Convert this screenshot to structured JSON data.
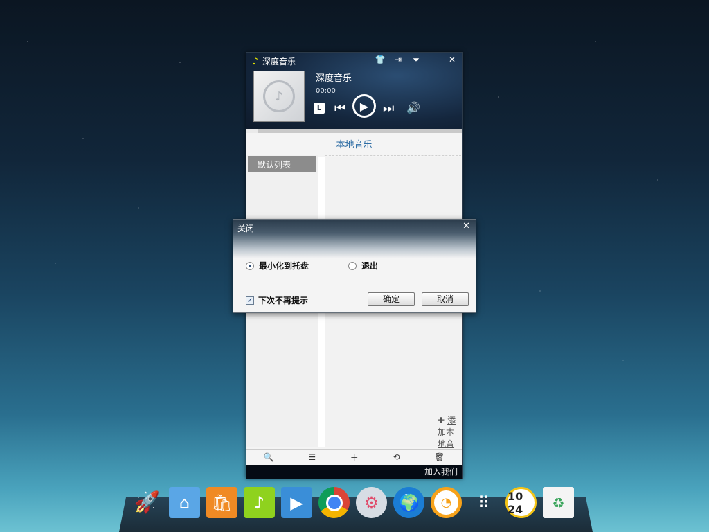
{
  "player": {
    "app_title": "深度音乐",
    "window_buttons": [
      "shirt-icon",
      "login-icon",
      "menu-down-icon",
      "minimize-icon",
      "close-icon"
    ],
    "song_title": "深度音乐",
    "time": "00:00",
    "mode_label": "L",
    "local_music_title": "本地音乐",
    "default_list": "默认列表",
    "add_local_music": "添加本地音乐",
    "join_us": "加入我们",
    "toolbar_icons": [
      "search-icon",
      "list-icon",
      "add-icon",
      "repeat-icon",
      "delete-icon"
    ]
  },
  "dialog": {
    "title": "关闭",
    "option_minimize": "最小化到托盘",
    "option_exit": "退出",
    "selected_option": "最小化到托盘",
    "dont_ask_again": "下次不再提示",
    "dont_ask_checked": true,
    "ok_label": "确定",
    "cancel_label": "取消"
  },
  "dock": {
    "apps": [
      "launcher-rocket-icon",
      "file-manager-icon",
      "software-center-icon",
      "deepin-music-icon",
      "media-player-icon",
      "chrome-icon",
      "settings-icon",
      "browser-globe-icon",
      "deepin-orange-icon",
      "app-grid-icon",
      "clock-icon",
      "trash-icon"
    ],
    "clock_text": "10 24"
  }
}
